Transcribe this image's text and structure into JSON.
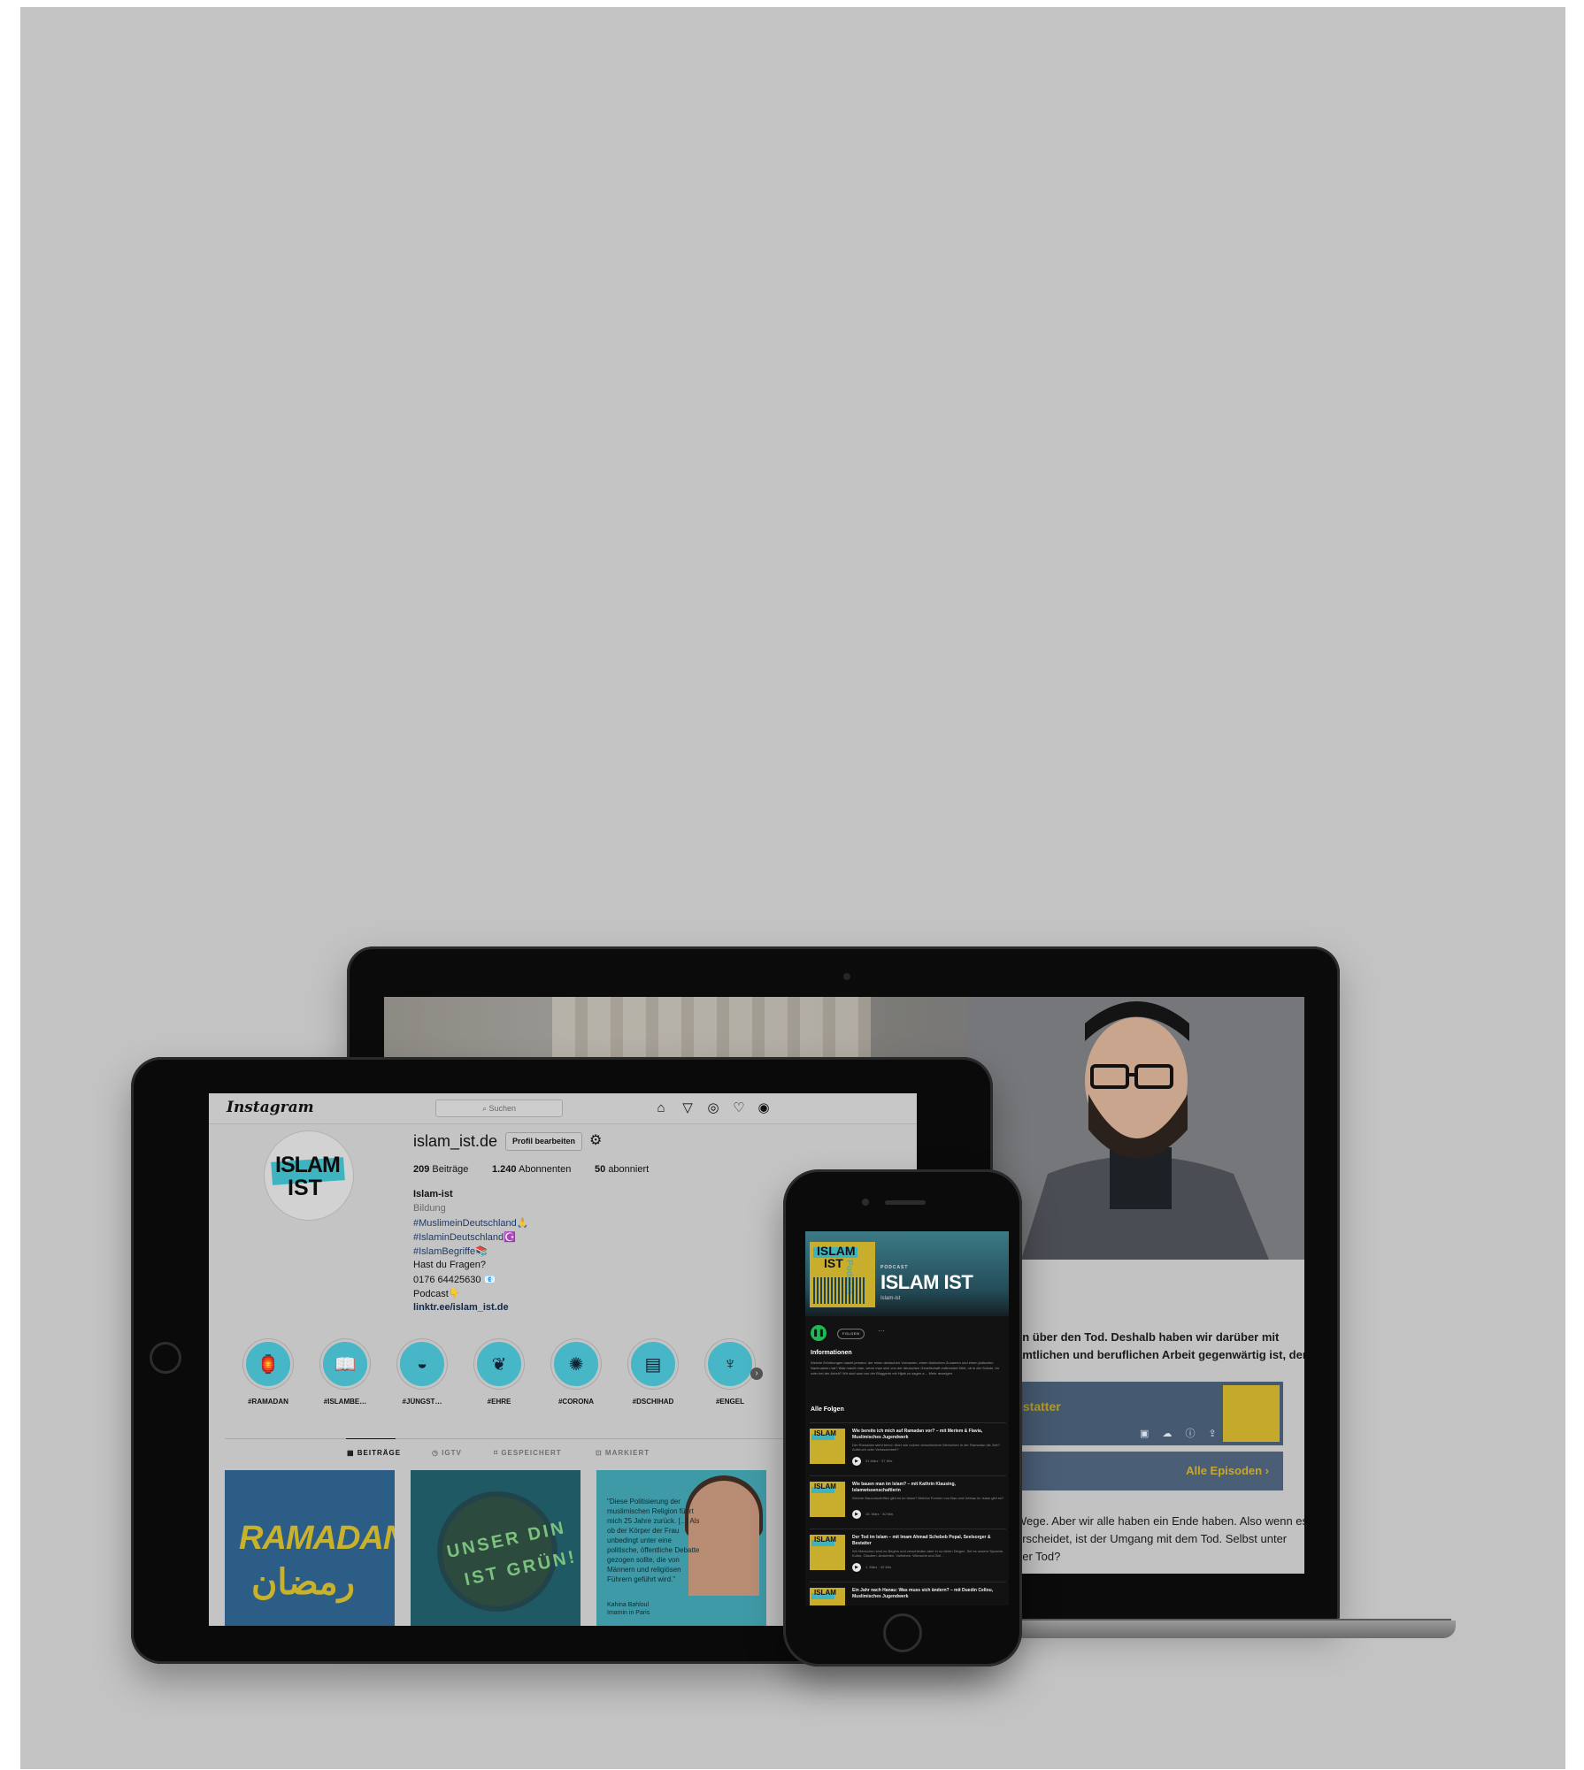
{
  "website": {
    "text_line_1": "en über den Tod. Deshalb haben wir darüber mit",
    "text_line_2": "amtlichen und beruflichen Arbeit gegenwärtig ist, dem",
    "podcast_title": "Bestatter",
    "episodes_link": "Alle Episoden ›",
    "text_line_3": "Wege. Aber wir alle haben ein Ende haben. Also wenn es",
    "text_line_4": "erscheidet, ist der Umgang mit dem Tod. Selbst unter",
    "text_line_5": "der Tod?"
  },
  "instagram": {
    "logo": "Instagram",
    "search_placeholder": "⌕ Suchen",
    "nav_icons": [
      "home-icon",
      "send-icon",
      "explore-icon",
      "heart-icon",
      "profile-icon"
    ],
    "avatar_line_1": "ISLAM",
    "avatar_line_2": "IST",
    "username": "islam_ist.de",
    "edit_profile": "Profil bearbeiten",
    "stats": {
      "posts_count": "209",
      "posts_label": "Beiträge",
      "followers_count": "1.240",
      "followers_label": "Abonnenten",
      "following_count": "50",
      "following_label": "abonniert"
    },
    "bio": {
      "name": "Islam-ist",
      "category": "Bildung",
      "tag_1": "#MuslimeinDeutschland🙏",
      "tag_2": "#IslaminDeutschland☪️",
      "tag_3": "#IslamBegriffe📚",
      "question": "Hast du Fragen?",
      "phone": "0176 64425630 📧",
      "podcast": "Podcast👇",
      "link": "linktr.ee/islam_ist.de"
    },
    "highlights": [
      {
        "label": "#RAMADAN",
        "icon": "lantern-icon",
        "glyph": "🏮"
      },
      {
        "label": "#ISLAMBE…",
        "icon": "quran-icon",
        "glyph": "📖"
      },
      {
        "label": "#JÜNGST…",
        "icon": "sun-icon",
        "glyph": "◒"
      },
      {
        "label": "#EHRE",
        "icon": "laurel-icon",
        "glyph": "❦"
      },
      {
        "label": "#CORONA",
        "icon": "virus-icon",
        "glyph": "✺"
      },
      {
        "label": "#DSCHIHAD",
        "icon": "book-icon",
        "glyph": "▤"
      },
      {
        "label": "#ENGEL",
        "icon": "angel-icon",
        "glyph": "♆"
      }
    ],
    "tabs": {
      "posts": "▦ BEITRÄGE",
      "igtv": "◷ IGTV",
      "saved": "⌑ GESPEICHERT",
      "tagged": "⊡ MARKIERT"
    },
    "posts": {
      "post_1_title": "RAMADAN",
      "post_1_arabic": "رمضان",
      "post_2_line_1": "UNSER DIN",
      "post_2_line_2": "IST GRÜN!",
      "post_3_quote": "\"Diese Politisierung der muslimischen Religion führt mich 25 Jahre zurück. [...] Als ob der Körper der Frau unbedingt unter eine politische, öffentliche Debatte gezogen sollte, die von Männern und religiösen Führern geführt wird.\"",
      "post_3_author": "Kahina Bahloul",
      "post_3_role": "Imamin in Paris"
    }
  },
  "spotify": {
    "cover_line_1": "ISLAM",
    "cover_line_2": "IST",
    "cover_tag": "Podcast",
    "label": "PODCAST",
    "title": "ISLAM IST",
    "subtitle": "Islam-ist",
    "follow": "FOLGEN",
    "more": "···",
    "info_heading": "Informationen",
    "info_text": "Welche Erfahrungen macht jemand, der einen deutschen Vornamen, einen türkischen Zunamen und einen jüdischen Nachnamen hat? Was macht man, wenn man sich von der deutschen Gesellschaft entfremdet fühlt, ob in der Schule, im oder bei der Arbeit? Wir sind was von der Bloggerin mit Hijab zu sagen a… Mehr anzeigen",
    "all_episodes_heading": "Alle Folgen",
    "episodes": [
      {
        "title": "Wie bereite ich mich auf Ramadan vor? – mit Meriem & Flavia, Muslimisches Jugendwerk",
        "desc": "Der Ramadan steht bevor. Aber wie nutzen verschiedene Menschen in der Ramadan die Zeit? Aufbruch oder Verlassenheit?",
        "meta": "31 März · 37 Min."
      },
      {
        "title": "Wie bauen man im Islam? – mit Kathrin Klausing, Islamwissenschaftlerin",
        "desc": "Welche Bauvorschriften gibt es im Islam? Welche Formen von Bau und Umbau im Islam gibt es?",
        "meta": "15. März · 40 Min."
      },
      {
        "title": "Der Tod im Islam – mit Imam Ahmad Schebeb Popal, Seelsorger & Bestatter",
        "desc": "Wir Menschen sind zu Beginn und verschieden aber in so vielen Dingen. Sei es unsere Sprache, Kultur, Glauben, Ansichten, Vorlieben, Wünsche und Ziel…",
        "meta": "1. März · 42 Min."
      },
      {
        "title": "Ein Jahr nach Hanau: Was muss sich ändern? – mit Duedin Cellou, Muslimisches Jugendwerk",
        "desc": "",
        "meta": ""
      }
    ]
  }
}
